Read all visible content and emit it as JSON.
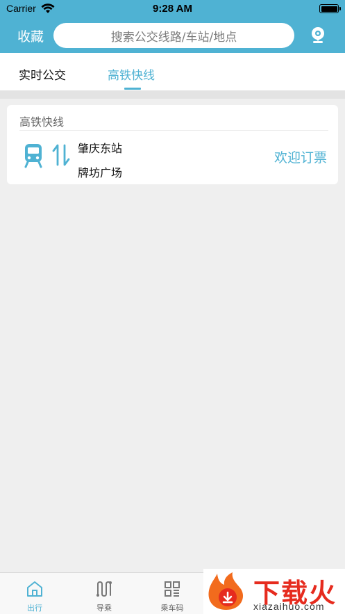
{
  "status_bar": {
    "carrier": "Carrier",
    "time": "9:28 AM"
  },
  "header": {
    "favorites_label": "收藏",
    "search_placeholder": "搜索公交线路/车站/地点",
    "location_icon": "location-pin-icon"
  },
  "tabs": [
    {
      "label": "实时公交",
      "active": false
    },
    {
      "label": "高铁快线",
      "active": true
    }
  ],
  "card": {
    "title": "高铁快线",
    "from_stop": "肇庆东站",
    "to_stop": "牌坊广场",
    "action_label": "欢迎订票",
    "icons": [
      "bus-icon",
      "swap-arrows-icon"
    ]
  },
  "bottom_nav": [
    {
      "label": "出行",
      "icon": "home-icon",
      "active": true
    },
    {
      "label": "导乘",
      "icon": "route-icon",
      "active": false
    },
    {
      "label": "乘车码",
      "icon": "qr-code-icon",
      "active": false
    }
  ],
  "watermark": {
    "text": "下载火",
    "url": "xiazaihuo.com"
  },
  "colors": {
    "accent": "#4fb2d3",
    "background": "#efefef",
    "watermark": "#e62b1e"
  }
}
